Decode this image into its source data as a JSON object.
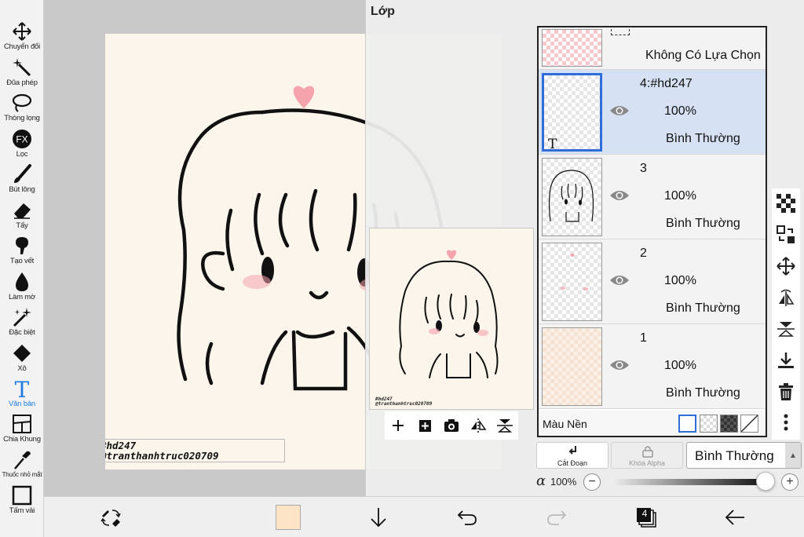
{
  "toolbar": {
    "items": [
      {
        "label": "Chuyển đổi",
        "icon": "move-icon"
      },
      {
        "label": "Đũa phép",
        "icon": "magic-wand-icon"
      },
      {
        "label": "Thòng lọng",
        "icon": "lasso-icon"
      },
      {
        "label": "Lọc",
        "icon": "fx-icon"
      },
      {
        "label": "Bút lông",
        "icon": "brush-icon"
      },
      {
        "label": "Tẩy",
        "icon": "eraser-icon"
      },
      {
        "label": "Tạo vết",
        "icon": "smudge-icon"
      },
      {
        "label": "Làm mờ",
        "icon": "blur-icon"
      },
      {
        "label": "Đặc biệt",
        "icon": "special-icon"
      },
      {
        "label": "Xô",
        "icon": "bucket-icon"
      },
      {
        "label": "Văn bản",
        "icon": "text-icon",
        "active": true
      },
      {
        "label": "Chia Khung",
        "icon": "frame-divider-icon"
      },
      {
        "label": "Thuốc nhỏ mắt",
        "icon": "eyedropper-icon"
      },
      {
        "label": "Tấm vải",
        "icon": "canvas-icon"
      }
    ],
    "fx_glyph": "FX",
    "text_glyph": "T"
  },
  "canvas": {
    "caption_line1": "#hd247",
    "caption_line2": "@tranthanhtruc020709",
    "background_color": "#fcf5ec"
  },
  "layers_panel": {
    "title": "Lớp",
    "preview_caption1": "#hd247",
    "preview_caption2": "@tranthanhtruc020709",
    "top_row_label": "Không Có Lựa Chọn",
    "layers": [
      {
        "name": "4:#hd247",
        "opacity": "100%",
        "blend": "Bình Thường",
        "selected": true,
        "thumb_glyph": "T"
      },
      {
        "name": "3",
        "opacity": "100%",
        "blend": "Bình Thường",
        "selected": false
      },
      {
        "name": "2",
        "opacity": "100%",
        "blend": "Bình Thường",
        "selected": false
      },
      {
        "name": "1",
        "opacity": "100%",
        "blend": "Bình Thường",
        "selected": false
      }
    ],
    "background_label": "Màu Nền",
    "cut_label": "Cắt Đoạn",
    "alpha_lock_label": "Khóa Alpha",
    "blend_mode": "Bình Thường",
    "alpha_symbol": "α",
    "alpha_value": "100%",
    "alpha_level": 1.0,
    "minus": "−",
    "plus": "+"
  },
  "bottom_bar": {
    "layer_count": "4",
    "color_swatch": "#fde3c6"
  },
  "colors": {
    "accent": "#2f6ed8",
    "active_tool": "#1e7be0",
    "blush": "#f5a3ad"
  }
}
